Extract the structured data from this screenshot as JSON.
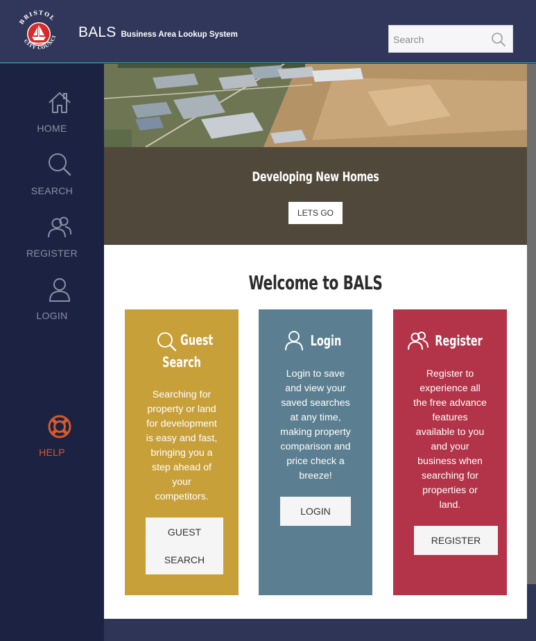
{
  "header": {
    "logo_text_top": "BRISTOL",
    "logo_text_bottom": "CITY COUNCIL",
    "title": "BALS",
    "subtitle": "Business Area Lookup System",
    "search_placeholder": "Search"
  },
  "sidebar": {
    "items": [
      {
        "label": "HOME",
        "icon": "home-icon"
      },
      {
        "label": "SEARCH",
        "icon": "search-icon"
      },
      {
        "label": "REGISTER",
        "icon": "users-icon"
      },
      {
        "label": "LOGIN",
        "icon": "user-icon"
      },
      {
        "label": "HELP",
        "icon": "lifebuoy-icon"
      }
    ]
  },
  "hero": {
    "title": "Developing New Homes",
    "button": "LETS GO"
  },
  "main": {
    "welcome": "Welcome to BALS",
    "cards": {
      "guest": {
        "title_line1": "Guest",
        "title_line2": "Search",
        "lines": [
          "Searching for",
          "property or land",
          "for development",
          "is easy and fast,",
          "bringing you a",
          "step ahead of",
          "your",
          "competitors."
        ],
        "button_line1": "GUEST",
        "button_line2": "SEARCH",
        "color": "#c8a03a"
      },
      "login": {
        "title": "Login",
        "lines": [
          "Login to save",
          "and view your",
          "saved searches",
          "at any time,",
          "making property",
          "comparison and",
          "price check a",
          "breeze!"
        ],
        "button": "LOGIN",
        "color": "#5b7f90"
      },
      "register": {
        "title": "Register",
        "lines": [
          "Register to",
          "experience all",
          "the free advance",
          "features",
          "available to you",
          "and your",
          "business when",
          "searching for",
          "properties or",
          "land."
        ],
        "button": "REGISTER",
        "color": "#b33348"
      }
    }
  },
  "colors": {
    "header_bg": "#31375a",
    "sidebar_bg": "#1c2241",
    "help_accent": "#d55a2c"
  }
}
